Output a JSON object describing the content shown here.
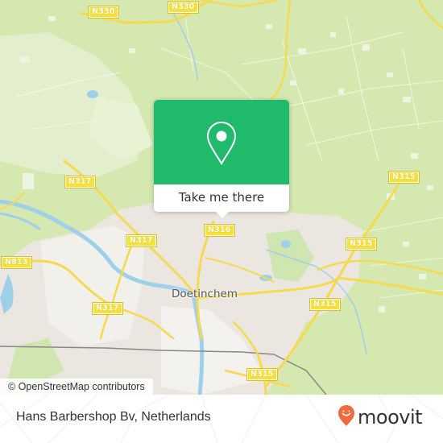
{
  "map": {
    "city_label": "Doetinchem",
    "attribution": "© OpenStreetMap contributors",
    "road_shields": [
      {
        "id": "n330-a",
        "label": "N330"
      },
      {
        "id": "n330-b",
        "label": "N330"
      },
      {
        "id": "n317-a",
        "label": "N317"
      },
      {
        "id": "n317-b",
        "label": "N317"
      },
      {
        "id": "n317-c",
        "label": "N317"
      },
      {
        "id": "n813",
        "label": "N813"
      },
      {
        "id": "n316",
        "label": "N316"
      },
      {
        "id": "n315-a",
        "label": "N315"
      },
      {
        "id": "n315-b",
        "label": "N315"
      },
      {
        "id": "n315-c",
        "label": "N315"
      },
      {
        "id": "n315-d",
        "label": "N315"
      }
    ],
    "colors": {
      "forest": "#d4e8b0",
      "meadow": "#e3efcc",
      "urban": "#ece6e0",
      "water": "#9fd0ea",
      "road": "#f6d94e",
      "shield": "#f6e03a"
    }
  },
  "popup": {
    "icon": "map-pin-icon",
    "button_label": "Take me there",
    "color": "#1fba6b"
  },
  "footer": {
    "place_name": "Hans Barbershop Bv, Netherlands",
    "brand": "moovit",
    "brand_icon": "moovit-smile-pin-icon",
    "brand_color": "#f26a3d"
  }
}
